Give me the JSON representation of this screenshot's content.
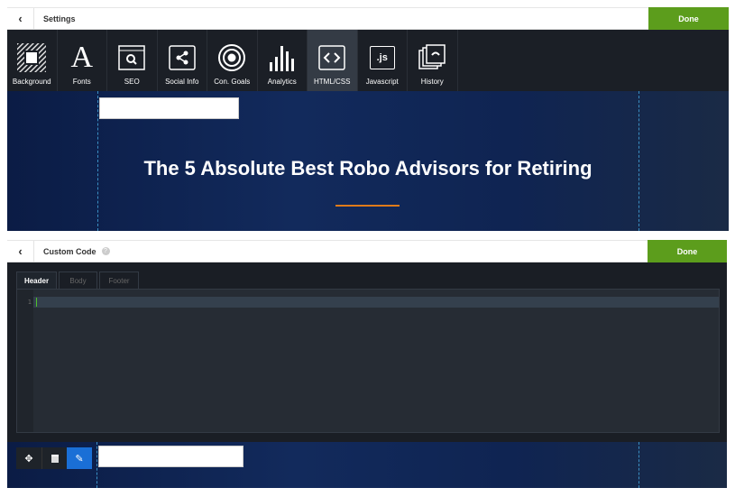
{
  "settings": {
    "title": "Settings",
    "done_label": "Done",
    "tools": [
      {
        "label": "Background",
        "icon": "background-icon"
      },
      {
        "label": "Fonts",
        "icon": "font-icon"
      },
      {
        "label": "SEO",
        "icon": "seo-search-icon"
      },
      {
        "label": "Social Info",
        "icon": "share-icon"
      },
      {
        "label": "Con. Goals",
        "icon": "target-icon"
      },
      {
        "label": "Analytics",
        "icon": "bar-chart-icon"
      },
      {
        "label": "HTML/CSS",
        "icon": "code-icon",
        "active": true
      },
      {
        "label": "Javascript",
        "icon": "js-icon"
      },
      {
        "label": "History",
        "icon": "history-icon"
      }
    ]
  },
  "hero": {
    "title": "The 5 Absolute Best Robo Advisors for Retiring",
    "accent": "#e07b1a"
  },
  "custom_code": {
    "title": "Custom Code",
    "help_icon": "help-icon",
    "done_label": "Done",
    "tabs": [
      {
        "label": "Header",
        "active": true
      },
      {
        "label": "Body"
      },
      {
        "label": "Footer"
      }
    ],
    "line_numbers": [
      "1"
    ]
  },
  "bottom_toolbar": {
    "buttons": [
      "move-icon",
      "trash-icon",
      "pencil-icon"
    ]
  },
  "colors": {
    "done": "#5c9d1c",
    "toolbar": "#1b1f26",
    "edit": "#1a6fd6"
  }
}
